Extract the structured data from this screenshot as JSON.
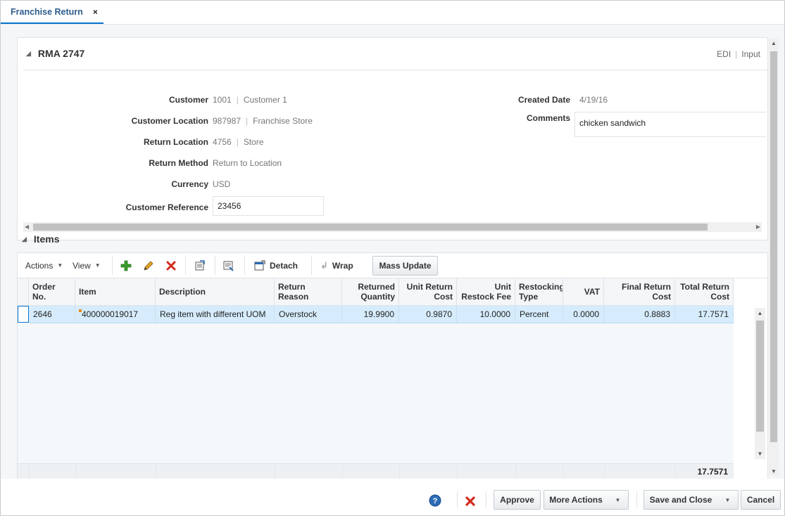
{
  "tab": {
    "label": "Franchise Return",
    "close": "×"
  },
  "rma": {
    "title": "RMA 2747",
    "links": [
      "EDI",
      "Input"
    ],
    "fields": {
      "customer": {
        "label": "Customer",
        "id": "1001",
        "name": "Customer 1"
      },
      "customer_location": {
        "label": "Customer Location",
        "id": "987987",
        "name": "Franchise Store"
      },
      "return_location": {
        "label": "Return Location",
        "id": "4756",
        "name": "Store"
      },
      "return_method": {
        "label": "Return Method",
        "value": "Return to Location"
      },
      "currency": {
        "label": "Currency",
        "value": "USD"
      },
      "customer_reference": {
        "label": "Customer Reference",
        "value": "23456"
      },
      "created_date": {
        "label": "Created Date",
        "value": "4/19/16"
      },
      "comments": {
        "label": "Comments",
        "value": "chicken sandwich"
      }
    }
  },
  "items": {
    "title": "Items",
    "toolbar": {
      "actions": "Actions",
      "view": "View",
      "detach": "Detach",
      "wrap": "Wrap",
      "mass_update": "Mass Update"
    },
    "columns": [
      {
        "l1": "Order No.",
        "l2": ""
      },
      {
        "l1": "Item",
        "l2": ""
      },
      {
        "l1": "Description",
        "l2": ""
      },
      {
        "l1": "Return",
        "l2": "Reason"
      },
      {
        "l1": "Returned",
        "l2": "Quantity"
      },
      {
        "l1": "Unit Return",
        "l2": "Cost"
      },
      {
        "l1": "Unit",
        "l2": "Restock Fee"
      },
      {
        "l1": "Restocking",
        "l2": "Type"
      },
      {
        "l1": "VAT",
        "l2": ""
      },
      {
        "l1": "Final Return",
        "l2": "Cost"
      },
      {
        "l1": "Total Return",
        "l2": "Cost"
      }
    ],
    "rows": [
      [
        "2646",
        "400000019017",
        "Reg item with different UOM",
        "Overstock",
        "19.9900",
        "0.9870",
        "10.0000",
        "Percent",
        "0.0000",
        "0.8883",
        "17.7571"
      ]
    ],
    "total": "17.7571"
  },
  "buttons": {
    "approve": "Approve",
    "more_actions": "More Actions",
    "save_and_close": "Save and Close",
    "cancel": "Cancel"
  }
}
